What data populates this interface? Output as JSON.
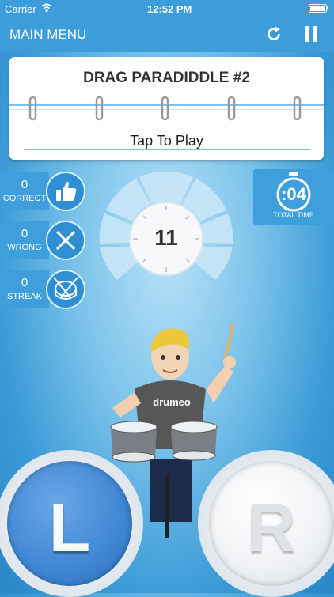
{
  "status_bar": {
    "carrier": "Carrier",
    "time": "12:52 PM"
  },
  "nav": {
    "main_menu": "MAIN MENU",
    "restart_icon": "restart-icon",
    "pause_icon": "pause-icon"
  },
  "exercise": {
    "title": "DRAG PARADIDDLE #2",
    "prompt": "Tap To Play"
  },
  "stats": {
    "correct": {
      "value": "0",
      "label": "CORRECT",
      "icon": "thumbs-up-icon"
    },
    "wrong": {
      "value": "0",
      "label": "WRONG",
      "icon": "x-icon"
    },
    "streak": {
      "value": "0",
      "label": "STREAK",
      "icon": "drum-icon"
    }
  },
  "timer": {
    "count": "11",
    "total_time_value": ":04",
    "total_time_label": "TOTAL TIME"
  },
  "drummer": {
    "shirt_text": "drumeo"
  },
  "pads": {
    "left": "L",
    "right": "R"
  },
  "colors": {
    "brand_blue": "#3d9ddb",
    "pad_blue": "#4a8fd8",
    "pad_white": "#f2f4f6"
  }
}
